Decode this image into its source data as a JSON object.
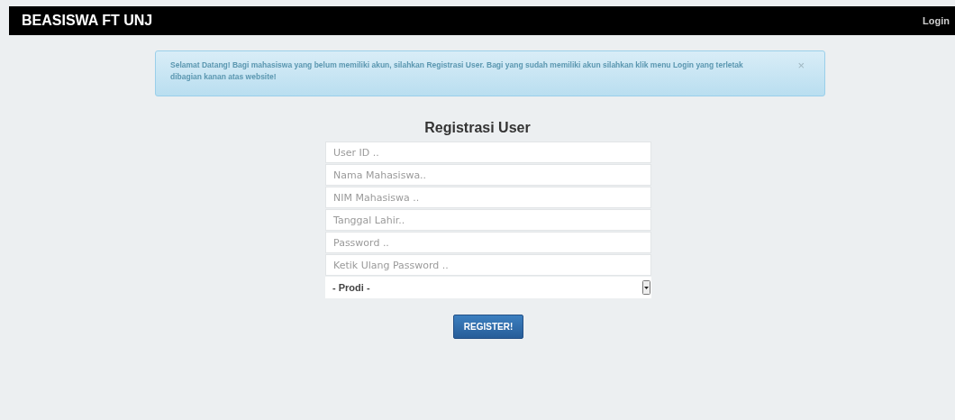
{
  "navbar": {
    "brand": "BEASISWA FT UNJ",
    "login": "Login"
  },
  "alert": {
    "message": "Selamat Datang! Bagi mahasiswa yang belum memiliki akun, silahkan Registrasi User. Bagi yang sudah memiliki akun silahkan klik menu Login yang terletak dibagian kanan atas website!",
    "close": "×"
  },
  "form": {
    "title": "Registrasi User",
    "fields": [
      {
        "placeholder": "User ID .."
      },
      {
        "placeholder": "Nama Mahasiswa.."
      },
      {
        "placeholder": "NIM Mahasiswa .."
      },
      {
        "placeholder": "Tanggal Lahir.."
      },
      {
        "placeholder": "Password .."
      },
      {
        "placeholder": "Ketik Ulang Password .."
      }
    ],
    "select": {
      "value": "- Prodi -"
    },
    "submit": "REGISTER!"
  }
}
